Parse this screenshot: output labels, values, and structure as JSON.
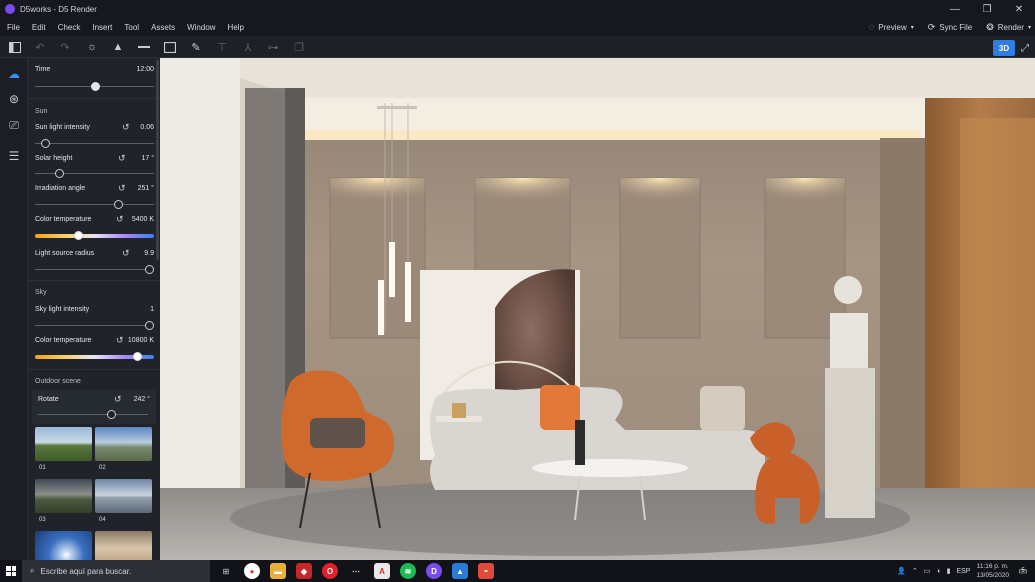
{
  "window": {
    "title": "D5works - D5 Render",
    "minimize": "—",
    "maximize": "❐",
    "close": "✕"
  },
  "menu": [
    "File",
    "Edit",
    "Check",
    "Insert",
    "Tool",
    "Assets",
    "Window",
    "Help"
  ],
  "menu_right": {
    "preview": "Preview",
    "sync": "Sync File",
    "render": "Render"
  },
  "toolbar": {
    "mode_3d": "3D"
  },
  "panel": {
    "time": {
      "label": "Time",
      "value": "12:00",
      "level": 0.5
    },
    "sun_section": "Sun",
    "sun_intensity": {
      "label": "Sun light intensity",
      "value": "0.06",
      "level": 0.08
    },
    "solar_height": {
      "label": "Solar height",
      "value": "17 °",
      "level": 0.2
    },
    "irradiation_angle": {
      "label": "Irradiation angle",
      "value": "251 °",
      "level": 0.7
    },
    "sun_color_temp": {
      "label": "Color temperature",
      "value": "5400 K",
      "level": 0.36
    },
    "light_radius": {
      "label": "Light source radius",
      "value": "9.9",
      "level": 0.96
    },
    "sky_section": "Sky",
    "sky_intensity": {
      "label": "Sky light intensity",
      "value": "1",
      "level": 0.96
    },
    "sky_color_temp": {
      "label": "Color temperature",
      "value": "10800 K",
      "level": 0.86
    },
    "outdoor_section": "Outdoor scene",
    "rotate": {
      "label": "Rotate",
      "value": "242 °",
      "level": 0.66
    },
    "scenes": [
      "01",
      "02",
      "03",
      "04"
    ]
  },
  "taskbar": {
    "search_placeholder": "Escribe aquí para buscar.",
    "language": "ESP",
    "time": "11:16 p. m.",
    "date": "13/05/2020",
    "notifications": "5"
  }
}
